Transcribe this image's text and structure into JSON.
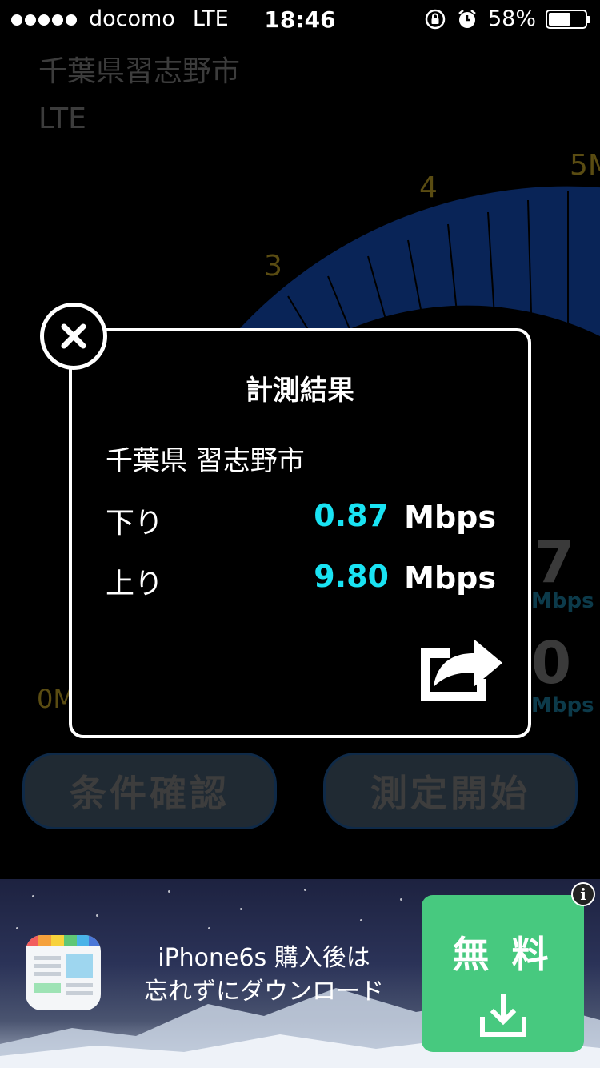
{
  "status_bar": {
    "carrier": "docomo",
    "network": "LTE",
    "time": "18:46",
    "battery": "58%",
    "battery_level": 0.58
  },
  "background": {
    "location": "千葉県習志野市",
    "network": "LTE",
    "gauge_labels": [
      "3",
      "4",
      "5M",
      "0M"
    ],
    "download_partial": "7",
    "upload_partial": "0",
    "unit": "Mbps",
    "accent_color": "#0b2a66",
    "buttons": {
      "check_conditions": "条件確認",
      "start_measurement": "測定開始"
    }
  },
  "modal": {
    "title": "計測結果",
    "location": "千葉県 習志野市",
    "download_label": "下り",
    "download_value": "0.87",
    "upload_label": "上り",
    "upload_value": "9.80",
    "unit": "Mbps",
    "value_color": "#19e3f3",
    "close_icon": "close-circle-icon",
    "share_icon": "share-icon"
  },
  "ad": {
    "line1": "iPhone6s 購入後は",
    "line2": "忘れずにダウンロード",
    "cta_label": "無 料",
    "cta_color": "#47c97f",
    "info": "i"
  }
}
